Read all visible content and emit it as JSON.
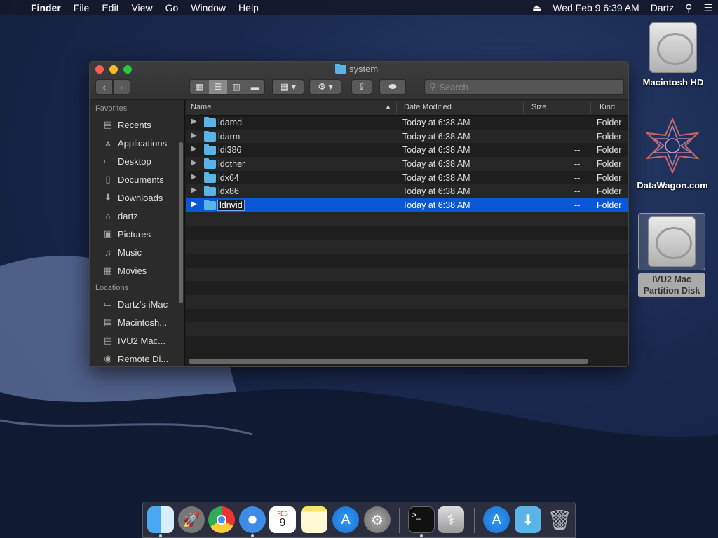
{
  "menubar": {
    "app": "Finder",
    "items": [
      "File",
      "Edit",
      "View",
      "Go",
      "Window",
      "Help"
    ],
    "datetime": "Wed Feb 9  6:39 AM",
    "user": "Dartz"
  },
  "window": {
    "title": "system",
    "search_placeholder": "Search"
  },
  "sidebar": {
    "favorites_heading": "Favorites",
    "favorites": [
      {
        "label": "Recents",
        "icon": "recents-icon"
      },
      {
        "label": "Applications",
        "icon": "applications-icon"
      },
      {
        "label": "Desktop",
        "icon": "desktop-icon"
      },
      {
        "label": "Documents",
        "icon": "documents-icon"
      },
      {
        "label": "Downloads",
        "icon": "downloads-icon"
      },
      {
        "label": "dartz",
        "icon": "home-icon"
      },
      {
        "label": "Pictures",
        "icon": "pictures-icon"
      },
      {
        "label": "Music",
        "icon": "music-icon"
      },
      {
        "label": "Movies",
        "icon": "movies-icon"
      }
    ],
    "locations_heading": "Locations",
    "locations": [
      {
        "label": "Dartz's iMac",
        "icon": "imac-icon"
      },
      {
        "label": "Macintosh...",
        "icon": "disk-icon"
      },
      {
        "label": "IVU2 Mac...",
        "icon": "disk-icon"
      },
      {
        "label": "Remote Di...",
        "icon": "remote-disc-icon"
      }
    ]
  },
  "columns": {
    "name": "Name",
    "date": "Date Modified",
    "size": "Size",
    "kind": "Kind"
  },
  "files": [
    {
      "name": "ldamd",
      "date": "Today at 6:38 AM",
      "size": "--",
      "kind": "Folder"
    },
    {
      "name": "ldarm",
      "date": "Today at 6:38 AM",
      "size": "--",
      "kind": "Folder"
    },
    {
      "name": "ldi386",
      "date": "Today at 6:38 AM",
      "size": "--",
      "kind": "Folder"
    },
    {
      "name": "ldother",
      "date": "Today at 6:38 AM",
      "size": "--",
      "kind": "Folder"
    },
    {
      "name": "ldx64",
      "date": "Today at 6:38 AM",
      "size": "--",
      "kind": "Folder"
    },
    {
      "name": "ldx86",
      "date": "Today at 6:38 AM",
      "size": "--",
      "kind": "Folder"
    },
    {
      "name": "ldnvid",
      "date": "Today at 6:38 AM",
      "size": "--",
      "kind": "Folder",
      "selected": true
    }
  ],
  "desktop": {
    "macintosh_hd": "Macintosh HD",
    "datawagon": "DataWagon.com",
    "partition_line1": "IVU2 Mac",
    "partition_line2": "Partition Disk"
  },
  "dock": {
    "calendar_month": "FEB",
    "calendar_day": "9"
  },
  "colors": {
    "selection": "#0a58d6",
    "folder": "#5ab4e8"
  }
}
